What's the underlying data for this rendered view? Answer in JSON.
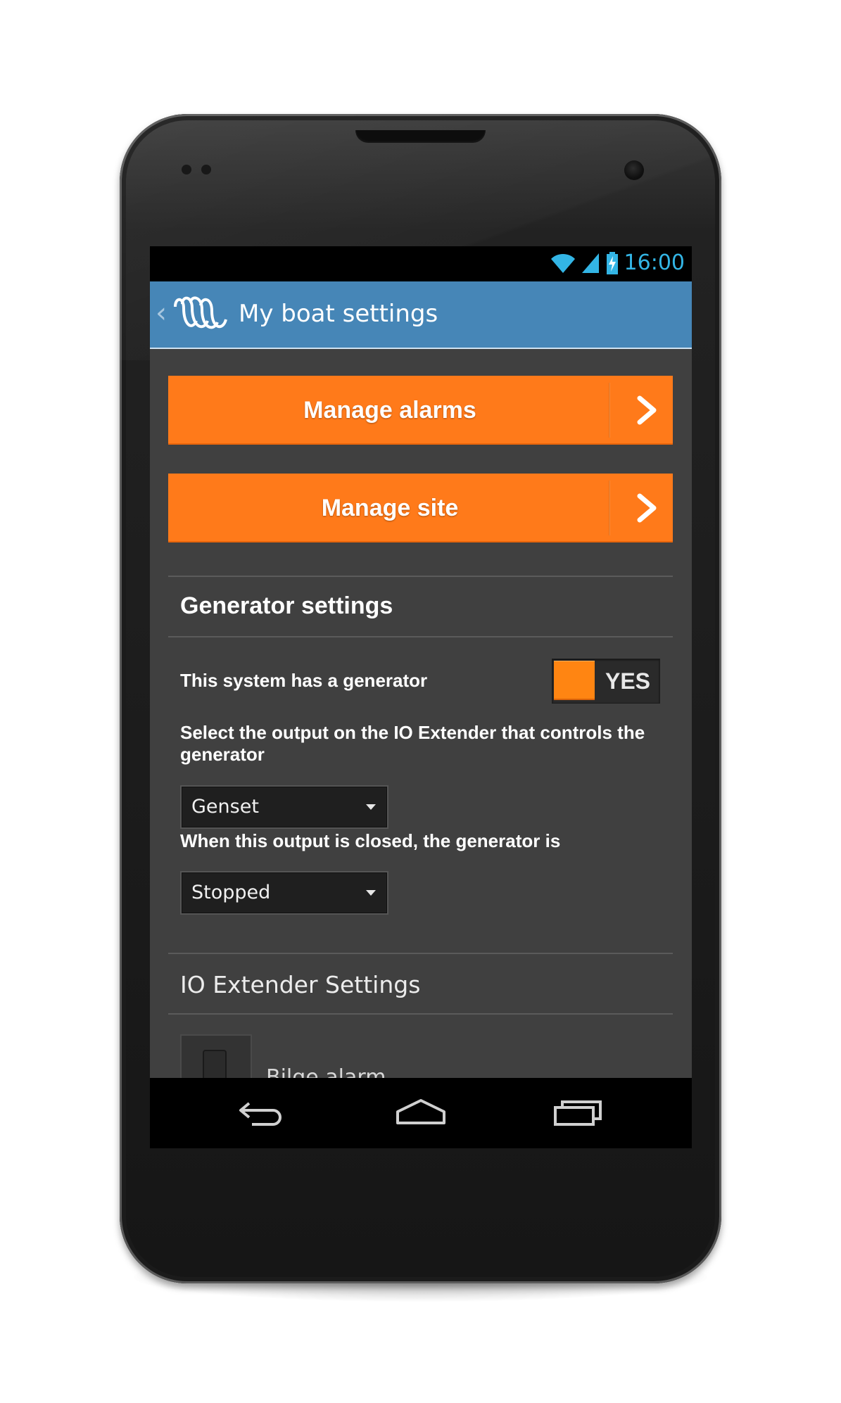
{
  "status_bar": {
    "time": "16:00",
    "icons": [
      "wifi-icon",
      "signal-icon",
      "battery-charging-icon"
    ]
  },
  "action_bar": {
    "title": "My boat settings",
    "up_icon": "chevron-left-icon",
    "logo_icon": "victron-logo-icon"
  },
  "buttons": {
    "manage_alarms": "Manage alarms",
    "manage_site": "Manage site"
  },
  "generator": {
    "section_title": "Generator settings",
    "has_generator_label": "This system has a generator",
    "has_generator_value": "YES",
    "output_label": "Select the output on the IO Extender that controls the generator",
    "output_value": "Genset",
    "closed_label": "When this output is closed, the generator is",
    "closed_value": "Stopped"
  },
  "io_extender": {
    "section_title": "IO Extender Settings",
    "bilge_label": "Bilge alarm"
  },
  "nav_bar": {
    "icons": [
      "back-icon",
      "home-icon",
      "recent-apps-icon"
    ]
  },
  "colors": {
    "accent_orange": "#ff7a1a",
    "action_bar_blue": "#4686b7",
    "clock_blue": "#33b5e5",
    "screen_bg": "#404040"
  }
}
